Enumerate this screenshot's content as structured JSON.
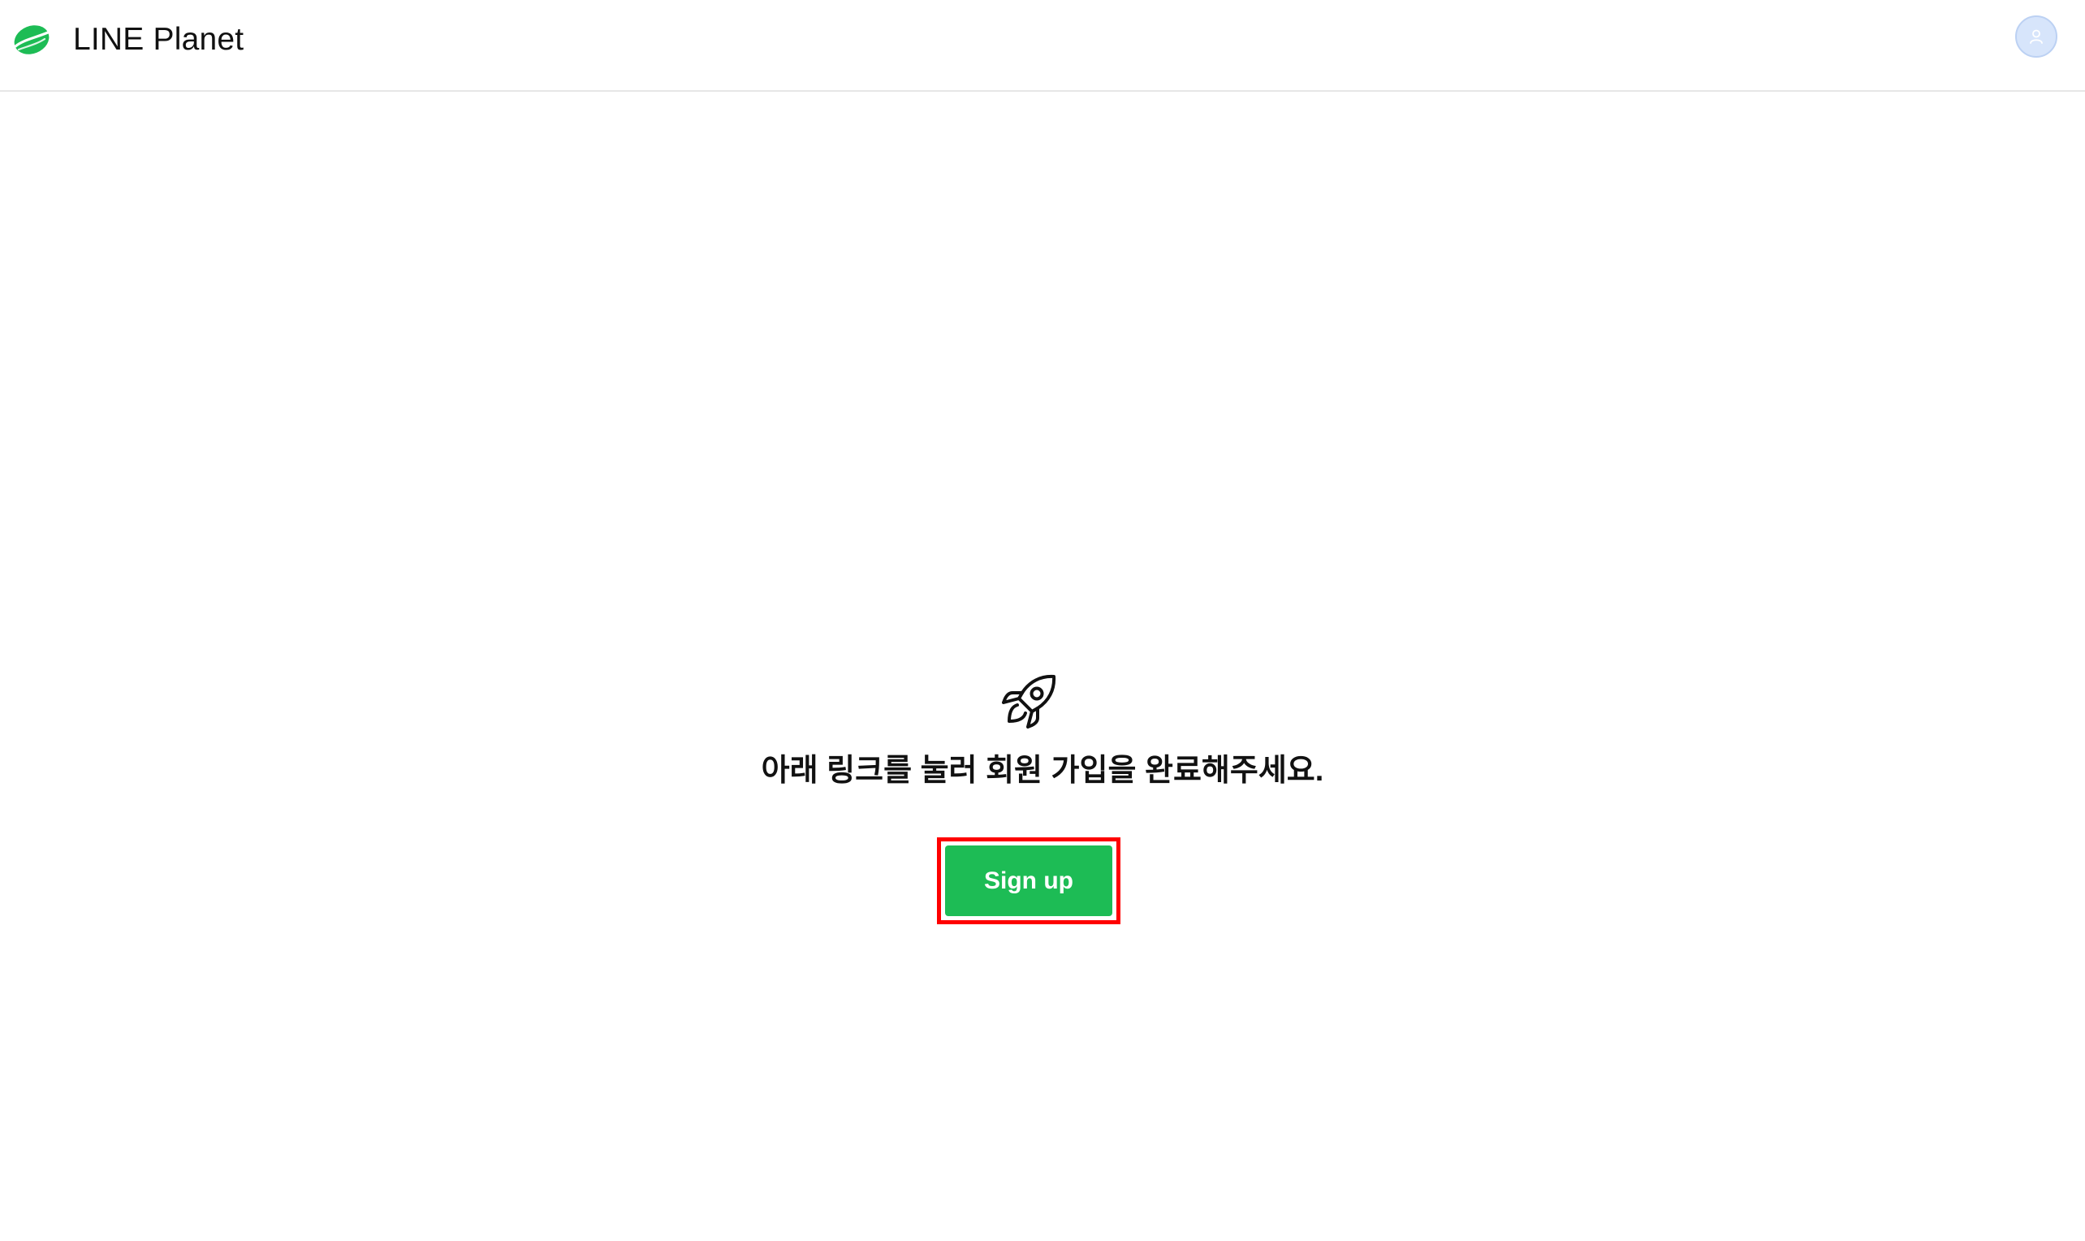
{
  "header": {
    "brand_name": "LINE Planet",
    "logo_icon": "leaf-logo-icon",
    "avatar_icon": "user-avatar-icon"
  },
  "main": {
    "icon": "rocket-icon",
    "message": "아래 링크를 눌러 회원 가입을 완료해주세요.",
    "signup_button_label": "Sign up"
  },
  "colors": {
    "brand_green": "#1DBC55",
    "highlight_red": "#FF0000",
    "avatar_bg": "#D7E5FB",
    "header_border": "#E6E6E6",
    "text": "#111111"
  }
}
